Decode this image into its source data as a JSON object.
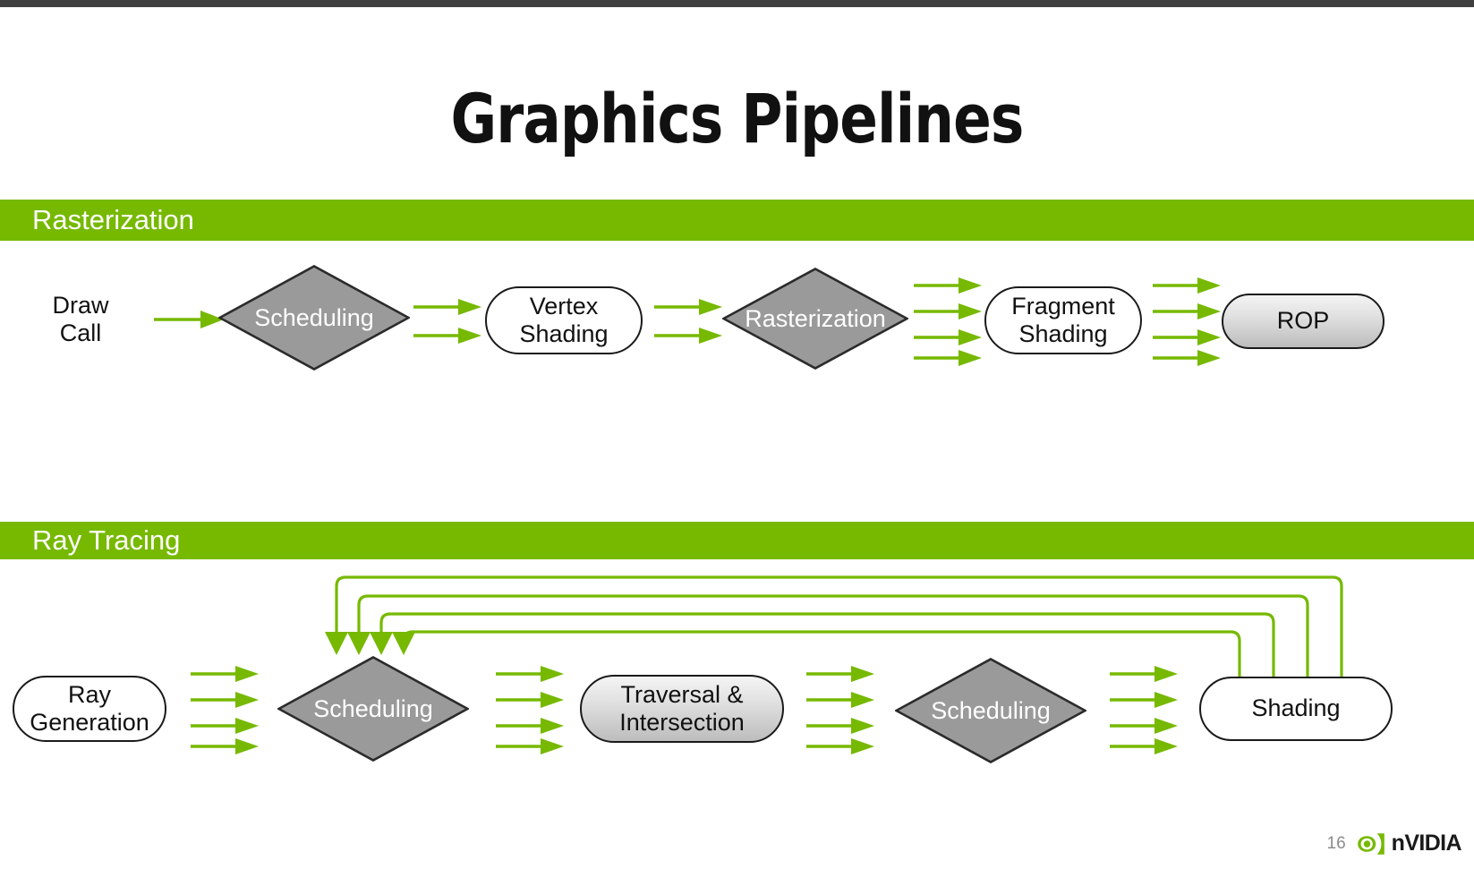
{
  "slide": {
    "title": "Graphics Pipelines",
    "page_number": "16",
    "brand": "NVIDIA",
    "brand_prefix": "n",
    "brand_rest": "VIDIA",
    "colors": {
      "brand_green": "#76b900",
      "band_green": "#76b900",
      "arrow_green": "#76b900",
      "diamond_gray": "#9a9a9a",
      "node_outline": "#1a1a1a",
      "title_text": "#111111",
      "band_text": "#ffffff",
      "page_number_text": "#8c8c8c",
      "top_bar": "#3f3f3f"
    }
  },
  "sections": [
    {
      "id": "rasterization",
      "band_label": "Rasterization",
      "nodes": [
        {
          "id": "draw-call",
          "label": "Draw\nCall",
          "shape": "plain"
        },
        {
          "id": "scheduling-1",
          "label": "Scheduling",
          "shape": "diamond"
        },
        {
          "id": "vertex-shading",
          "label": "Vertex\nShading",
          "shape": "stadium"
        },
        {
          "id": "rasterization",
          "label": "Rasterization",
          "shape": "diamond"
        },
        {
          "id": "fragment-shading",
          "label": "Fragment\nShading",
          "shape": "stadium"
        },
        {
          "id": "rop",
          "label": "ROP",
          "shape": "stadium-gradient"
        }
      ],
      "connectors": [
        {
          "from": "draw-call",
          "to": "scheduling-1",
          "arrows": 1
        },
        {
          "from": "scheduling-1",
          "to": "vertex-shading",
          "arrows": 2
        },
        {
          "from": "vertex-shading",
          "to": "rasterization",
          "arrows": 2
        },
        {
          "from": "rasterization",
          "to": "fragment-shading",
          "arrows": 4
        },
        {
          "from": "fragment-shading",
          "to": "rop",
          "arrows": 4
        }
      ]
    },
    {
      "id": "ray-tracing",
      "band_label": "Ray Tracing",
      "nodes": [
        {
          "id": "ray-generation",
          "label": "Ray\nGeneration",
          "shape": "stadium"
        },
        {
          "id": "scheduling-2",
          "label": "Scheduling",
          "shape": "diamond"
        },
        {
          "id": "traversal",
          "label": "Traversal &\nIntersection",
          "shape": "stadium-gradient"
        },
        {
          "id": "scheduling-3",
          "label": "Scheduling",
          "shape": "diamond"
        },
        {
          "id": "shading",
          "label": "Shading",
          "shape": "stadium"
        }
      ],
      "connectors": [
        {
          "from": "ray-generation",
          "to": "scheduling-2",
          "arrows": 4
        },
        {
          "from": "scheduling-2",
          "to": "traversal",
          "arrows": 4
        },
        {
          "from": "traversal",
          "to": "scheduling-3",
          "arrows": 4
        },
        {
          "from": "scheduling-3",
          "to": "shading",
          "arrows": 4
        }
      ],
      "feedback_loops": {
        "count": 4,
        "from": "shading",
        "to": "scheduling-2",
        "description": "four nested feedback paths from Shading back to Scheduling"
      }
    }
  ]
}
